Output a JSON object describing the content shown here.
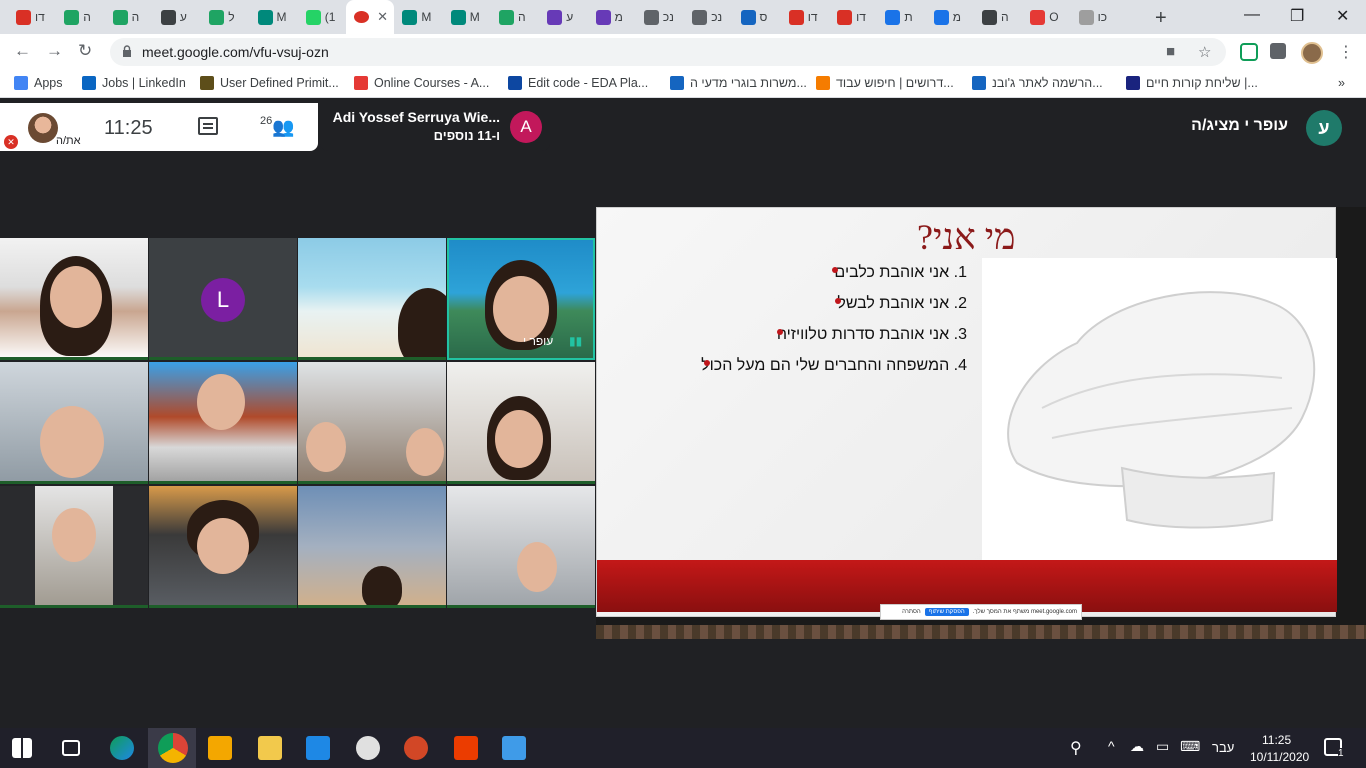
{
  "browser": {
    "tabs": [
      {
        "label": "דו",
        "icon": "gmail-icon",
        "color": "#d93025"
      },
      {
        "label": "ה",
        "icon": "drive-icon",
        "color": "#1fa463"
      },
      {
        "label": "ה",
        "icon": "drive-icon",
        "color": "#1fa463"
      },
      {
        "label": "ע",
        "icon": "contact-icon",
        "color": "#3c4043"
      },
      {
        "label": "ל",
        "icon": "drive-icon",
        "color": "#1fa463"
      },
      {
        "label": "M",
        "icon": "meet-icon",
        "color": "#00897b"
      },
      {
        "label": "(1",
        "icon": "whatsapp-icon",
        "color": "#25d366"
      },
      {
        "label": "",
        "icon": "record-icon",
        "color": "#d93025",
        "active": true
      },
      {
        "label": "M",
        "icon": "meet-icon",
        "color": "#00897b"
      },
      {
        "label": "M",
        "icon": "meet-icon",
        "color": "#00897b"
      },
      {
        "label": "ה",
        "icon": "drive-icon",
        "color": "#1fa463"
      },
      {
        "label": "ע",
        "icon": "forms-icon",
        "color": "#673ab7"
      },
      {
        "label": "מ",
        "icon": "forms-icon",
        "color": "#673ab7"
      },
      {
        "label": "נכ",
        "icon": "globe-icon",
        "color": "#5f6368"
      },
      {
        "label": "נכ",
        "icon": "globe-icon",
        "color": "#5f6368"
      },
      {
        "label": "ס",
        "icon": "s-icon",
        "color": "#1565c0"
      },
      {
        "label": "דו",
        "icon": "gmail-icon",
        "color": "#d93025"
      },
      {
        "label": "דו",
        "icon": "gmail-icon",
        "color": "#d93025"
      },
      {
        "label": "ת",
        "icon": "contact-icon",
        "color": "#1a73e8"
      },
      {
        "label": "מ",
        "icon": "chat-icon",
        "color": "#1a73e8"
      },
      {
        "label": "ה",
        "icon": "news-icon",
        "color": "#3c4043"
      },
      {
        "label": "O",
        "icon": "s-icon",
        "color": "#e53935"
      },
      {
        "label": "כו",
        "icon": "doc-icon",
        "color": "#9e9e9e"
      }
    ],
    "close_tab_glyph": "✕",
    "new_tab_glyph": "+",
    "window_controls": {
      "minimize": "—",
      "restore": "❐",
      "close": "✕"
    },
    "nav": {
      "back": "←",
      "forward": "→",
      "reload": "↻"
    },
    "url": "meet.google.com/vfu-vsuj-ozn",
    "menu_glyph": "⋮",
    "bookmarks": [
      {
        "label": "Apps",
        "color": "#4285f4"
      },
      {
        "label": "Jobs | LinkedIn",
        "color": "#0a66c2"
      },
      {
        "label": "User Defined Primit...",
        "color": "#5d4e1a"
      },
      {
        "label": "Online Courses - A...",
        "color": "#e53935"
      },
      {
        "label": "Edit code - EDA Pla...",
        "color": "#0d47a1"
      },
      {
        "label": "משרות בוגרי מדעי ה...",
        "color": "#1565c0"
      },
      {
        "label": "דרושים | חיפוש עבוד...",
        "color": "#f57c00"
      },
      {
        "label": "הרשמה לאתר ג'ובנ...",
        "color": "#1565c0"
      },
      {
        "label": "שליחת קורות חיים |...",
        "color": "#1a237e"
      }
    ],
    "bookmarks_overflow": "»"
  },
  "meet": {
    "self_label": "את/ה",
    "time": "11:25",
    "participant_count": "26",
    "presenter": {
      "name": "Adi Yossef Serruya Wie...",
      "more": "ו-11 נוספים",
      "avatar_letter": "A"
    },
    "presenting_label": "עופר י מציג/ה",
    "presenting_avatar_letter": "ע",
    "tiles": [
      {
        "id": "tile-1"
      },
      {
        "id": "tile-2",
        "avatar_letter": "L"
      },
      {
        "id": "tile-3"
      },
      {
        "id": "tile-4",
        "name": "עופר י",
        "speaking_glyph": "▮▮"
      },
      {
        "id": "tile-5"
      },
      {
        "id": "tile-6"
      },
      {
        "id": "tile-7"
      },
      {
        "id": "tile-8"
      },
      {
        "id": "tile-9"
      },
      {
        "id": "tile-10"
      },
      {
        "id": "tile-11"
      },
      {
        "id": "tile-12"
      }
    ]
  },
  "slide": {
    "title": "מי אני?",
    "items": [
      "1. אני אוהבת כלבים",
      "2. אני אוהבת לבשל",
      "3. אני אוהבת סדרות טלוויזיה",
      "4. המשפחה והחברים שלי הם מעל הכול"
    ],
    "share_bar": {
      "text": "meet.google.com משתף את המסך שלך.",
      "stop": "הפסקת שיתוף",
      "hide": "הסתרה"
    }
  },
  "taskbar": {
    "time": "11:25",
    "date": "10/11/2020",
    "language": "עבר",
    "notification_count": "1"
  }
}
